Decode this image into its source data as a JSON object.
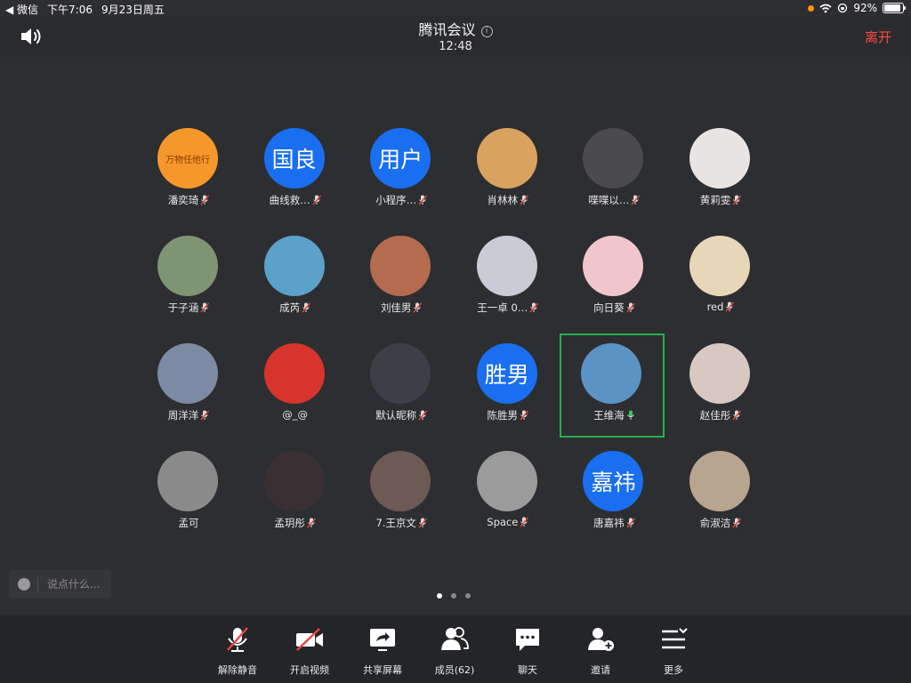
{
  "status_bar": {
    "back_app": "◀ 微信",
    "time": "下午7:06",
    "date": "9月23日周五",
    "battery": "92%",
    "battery_level": 0.92
  },
  "header": {
    "title": "腾讯会议",
    "elapsed": "12:48",
    "leave_label": "离开"
  },
  "participants": [
    {
      "name": "潘奕琦",
      "avatar_text": "万物任他行",
      "avatar_color": "#f5972a",
      "mic": "muted"
    },
    {
      "name": "曲线救…",
      "avatar_text": "国良",
      "avatar_color": "#1a6ef0",
      "mic": "muted"
    },
    {
      "name": "小程序…",
      "avatar_text": "用户",
      "avatar_color": "#1a6ef0",
      "mic": "muted"
    },
    {
      "name": "肖林林",
      "avatar_text": "",
      "avatar_color": "#d9a25f",
      "mic": "muted"
    },
    {
      "name": "喋喋以…",
      "avatar_text": "",
      "avatar_color": "#4a4a4f",
      "mic": "muted"
    },
    {
      "name": "黄莉雯",
      "avatar_text": "",
      "avatar_color": "#e9e4e4",
      "mic": "muted"
    },
    {
      "name": "于子涵",
      "avatar_text": "",
      "avatar_color": "#7f9473",
      "mic": "muted"
    },
    {
      "name": "成芮",
      "avatar_text": "",
      "avatar_color": "#5aa2c9",
      "mic": "muted"
    },
    {
      "name": "刘佳男",
      "avatar_text": "",
      "avatar_color": "#b46b4e",
      "mic": "muted"
    },
    {
      "name": "王一卓 0…",
      "avatar_text": "",
      "avatar_color": "#c9ccd6",
      "mic": "muted"
    },
    {
      "name": "向日葵",
      "avatar_text": "",
      "avatar_color": "#f0c6cc",
      "mic": "muted"
    },
    {
      "name": "red",
      "avatar_text": "",
      "avatar_color": "#e8d6b8",
      "mic": "muted"
    },
    {
      "name": "周洋洋",
      "avatar_text": "",
      "avatar_color": "#7d8aa3",
      "mic": "muted"
    },
    {
      "name": "@_@",
      "avatar_text": "",
      "avatar_color": "#d6342c",
      "mic": "none"
    },
    {
      "name": "默认昵称",
      "avatar_text": "",
      "avatar_color": "#3c3f48",
      "mic": "muted"
    },
    {
      "name": "陈胜男",
      "avatar_text": "胜男",
      "avatar_color": "#1a6ef0",
      "mic": "muted"
    },
    {
      "name": "王维海",
      "avatar_text": "",
      "avatar_color": "#5a93c4",
      "mic": "active",
      "active": true
    },
    {
      "name": "赵佳彤",
      "avatar_text": "",
      "avatar_color": "#d7c9c2",
      "mic": "muted"
    },
    {
      "name": "孟可",
      "avatar_text": "",
      "avatar_color": "#8a8a8a",
      "mic": "none"
    },
    {
      "name": "孟玥彤",
      "avatar_text": "",
      "avatar_color": "#3a3034",
      "mic": "muted"
    },
    {
      "name": "7.王京文",
      "avatar_text": "",
      "avatar_color": "#6d5a55",
      "mic": "muted"
    },
    {
      "name": "Space",
      "avatar_text": "",
      "avatar_color": "#9b9b9b",
      "mic": "muted"
    },
    {
      "name": "唐嘉祎",
      "avatar_text": "嘉祎",
      "avatar_color": "#1a6ef0",
      "mic": "muted"
    },
    {
      "name": "俞淑洁",
      "avatar_text": "",
      "avatar_color": "#b8a58f",
      "mic": "muted"
    }
  ],
  "comment": {
    "placeholder": "说点什么..."
  },
  "pagination": {
    "pages": 3,
    "current": 1
  },
  "toolbar": [
    {
      "label": "解除静音",
      "icon": "mic-muted-icon"
    },
    {
      "label": "开启视频",
      "icon": "video-off-icon"
    },
    {
      "label": "共享屏幕",
      "icon": "share-screen-icon"
    },
    {
      "label": "成员(62)",
      "icon": "members-icon"
    },
    {
      "label": "聊天",
      "icon": "chat-icon"
    },
    {
      "label": "邀请",
      "icon": "invite-icon"
    },
    {
      "label": "更多",
      "icon": "more-icon"
    }
  ],
  "colors": {
    "background": "#2d2e31",
    "toolbar": "#242528",
    "leave": "#ff4a40",
    "active_border": "#22b14c",
    "mute_red": "#e8453c",
    "mic_green": "#3cc45a"
  }
}
